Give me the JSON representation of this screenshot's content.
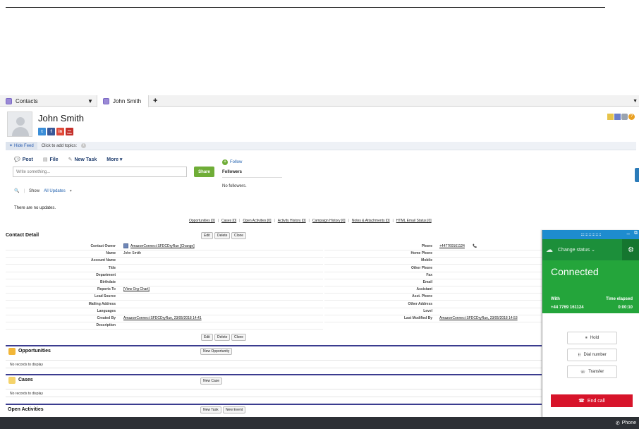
{
  "tabs": {
    "contacts": "Contacts",
    "contact": "John Smith",
    "add": "+",
    "dropdown": "▼"
  },
  "header": {
    "title": "John Smith",
    "social": [
      "t",
      "f",
      "in",
      "You Tube"
    ]
  },
  "feed": {
    "hide_feed": "Hide Feed",
    "add_topics": "Click to add topics:",
    "post": "Post",
    "file": "File",
    "new_task": "New Task",
    "more": "More ▾",
    "placeholder": "Write something...",
    "share": "Share",
    "follow": "Follow",
    "followers": "Followers",
    "no_followers": "No followers.",
    "show_label": "Show",
    "show_value": "All Updates",
    "no_updates": "There are no updates."
  },
  "related_links": [
    "Opportunities [0]",
    "Cases [0]",
    "Open Activities [0]",
    "Activity History [0]",
    "Campaign History [0]",
    "Notes & Attachments [0]",
    "HTML Email Status [0]"
  ],
  "detail": {
    "title": "Contact Detail",
    "buttons": {
      "edit": "Edit",
      "delete": "Delete",
      "clone": "Clone"
    },
    "left": [
      {
        "label": "Contact Owner",
        "value": "AmazonConnect SFDCDryRun [Change]"
      },
      {
        "label": "Name",
        "value": "John Smith"
      },
      {
        "label": "Account Name",
        "value": ""
      },
      {
        "label": "Title",
        "value": ""
      },
      {
        "label": "Department",
        "value": ""
      },
      {
        "label": "Birthdate",
        "value": ""
      },
      {
        "label": "Reports To",
        "value": "[View Org Chart]"
      },
      {
        "label": "Lead Source",
        "value": ""
      },
      {
        "label": "Mailing Address",
        "value": ""
      },
      {
        "label": "Languages",
        "value": ""
      },
      {
        "label": "Created By",
        "value": "AmazonConnect SFDCDryRun, 23/05/2018 14:41"
      },
      {
        "label": "Description",
        "value": ""
      }
    ],
    "right": [
      {
        "label": "Phone",
        "value": "+447769161124"
      },
      {
        "label": "Home Phone",
        "value": ""
      },
      {
        "label": "Mobile",
        "value": ""
      },
      {
        "label": "Other Phone",
        "value": ""
      },
      {
        "label": "Fax",
        "value": ""
      },
      {
        "label": "Email",
        "value": ""
      },
      {
        "label": "Assistant",
        "value": ""
      },
      {
        "label": "Asst. Phone",
        "value": ""
      },
      {
        "label": "Other Address",
        "value": ""
      },
      {
        "label": "Level",
        "value": ""
      },
      {
        "label": "Last Modified By",
        "value": "AmazonConnect SFDCDryRun, 23/05/2018 14:53"
      }
    ]
  },
  "related_lists": {
    "opportunities": {
      "title": "Opportunities",
      "button": "New Opportunity",
      "empty": "No records to display"
    },
    "cases": {
      "title": "Cases",
      "button": "New Case",
      "empty": "No records to display"
    },
    "open_activities": {
      "title": "Open Activities",
      "button_task": "New Task",
      "button_event": "New Event"
    }
  },
  "softphone": {
    "status": "Change status",
    "state": "Connected",
    "with_label": "With",
    "elapsed_label": "Time elapsed",
    "with_value": "+44 7769 161124",
    "elapsed_value": "0:00:10",
    "hold": "Hold",
    "dial": "Dial number",
    "transfer": "Transfer",
    "end_call": "End call",
    "colors": {
      "status_bar": "#1c8f3a",
      "connected": "#24a53b",
      "end_call": "#d7142a",
      "header": "#1e8ccf"
    }
  },
  "bottom": {
    "phone": "Phone"
  }
}
